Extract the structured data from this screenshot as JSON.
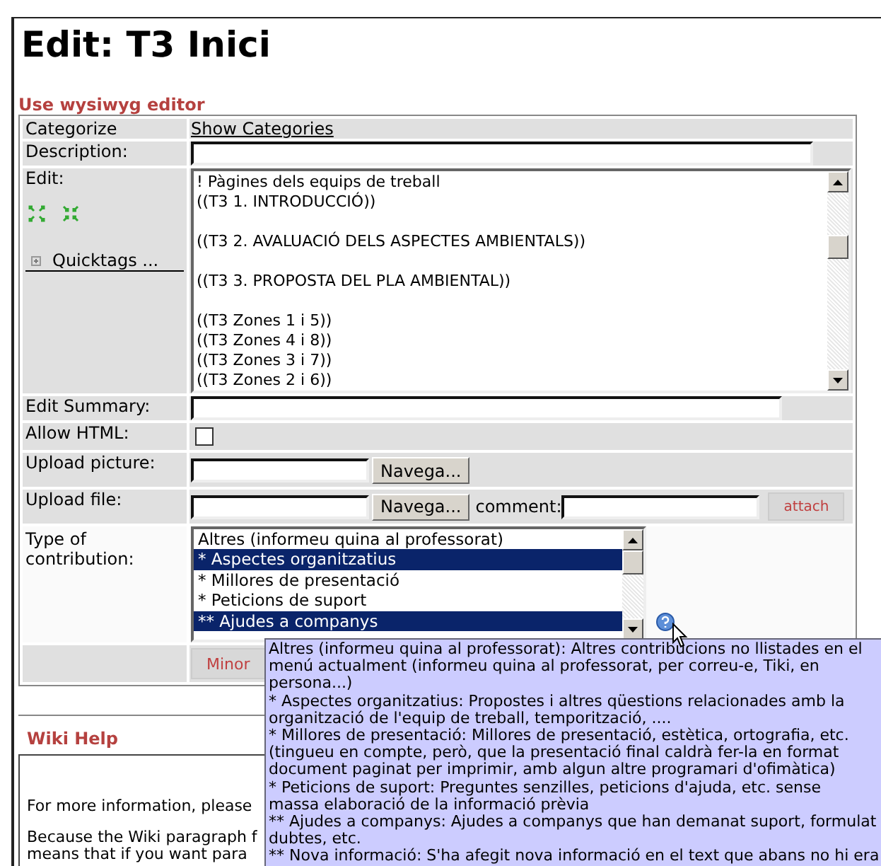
{
  "page_title": "Edit: T3 Inici",
  "wysiwyg_link": "Use wysiwyg editor",
  "form": {
    "categorize": {
      "label": "Categorize",
      "link": "Show Categories"
    },
    "description": {
      "label": "Description:"
    },
    "edit": {
      "label": "Edit:",
      "quicktags": "Quicktags ...",
      "content": "! Pàgines dels equips de treball\n((T3 1. INTRODUCCIÓ))\n\n((T3 2. AVALUACIÓ DELS ASPECTES AMBIENTALS))\n\n((T3 3. PROPOSTA DEL PLA AMBIENTAL))\n\n((T3 Zones 1 i 5))\n((T3 Zones 4 i 8))\n((T3 Zones 3 i 7))\n((T3 Zones 2 i 6))"
    },
    "edit_summary": {
      "label": "Edit Summary:"
    },
    "allow_html": {
      "label": "Allow HTML:",
      "checked": false
    },
    "upload_picture": {
      "label": "Upload picture:",
      "browse": "Navega..."
    },
    "upload_file": {
      "label": "Upload file:",
      "browse": "Navega...",
      "comment_label": "comment:",
      "attach": "attach"
    },
    "contribution": {
      "label": "Type of contribution:",
      "options": [
        {
          "label": "Altres (informeu quina al professorat)",
          "selected": false
        },
        {
          "label": "* Aspectes organitzatius",
          "selected": true
        },
        {
          "label": "* Millores de presentació",
          "selected": false
        },
        {
          "label": "* Peticions de suport",
          "selected": false
        },
        {
          "label": "** Ajudes a companys",
          "selected": true
        }
      ]
    },
    "buttons": [
      "Minor"
    ]
  },
  "wiki_help": {
    "title": "Wiki Help",
    "lines": [
      "For more information, please",
      "Because the Wiki paragraph f",
      "means that if you want para"
    ]
  },
  "tooltip": {
    "lines": [
      "Altres (informeu quina al professorat): Altres contribucions no llistades en el",
      "menú actualment (informeu quina al professorat, per correu-e, Tiki, en",
      "persona...)",
      "* Aspectes organitzatius: Propostes i altres qüestions relacionades amb la",
      "organització de l'equip de treball, temporització, ....",
      "* Millores de presentació: Millores de presentació, estètica, ortografia, etc.",
      "(tingueu en compte, però, que la presentació final caldrà fer-la en format",
      "document paginat per imprimir, amb algun altre programari d'ofimàtica)",
      "* Peticions de suport: Preguntes senzilles, peticions d'ajuda, etc. sense",
      "massa elaboració de la informació prèvia",
      "** Ajudes a companys: Ajudes a companys que han demanat suport, formulat",
      "dubtes, etc.",
      "** Nova informació: S'ha afegit nova informació en el text que abans no hi era"
    ]
  }
}
